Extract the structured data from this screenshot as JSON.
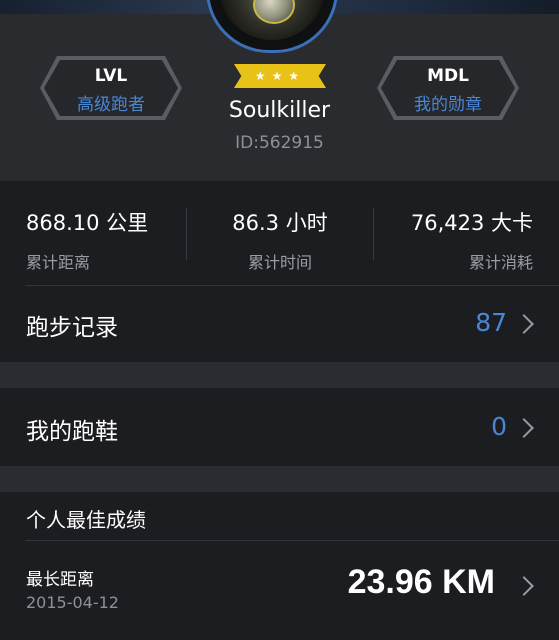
{
  "profile": {
    "username": "Soulkiller",
    "user_id": "ID:562915",
    "rank_stars": "★★★"
  },
  "badges": {
    "level": {
      "code": "LVL",
      "label": "高级跑者"
    },
    "medal": {
      "code": "MDL",
      "label": "我的勋章"
    }
  },
  "stats": [
    {
      "value": "868.10 公里",
      "label": "累计距离"
    },
    {
      "value": "86.3 小时",
      "label": "累计时间"
    },
    {
      "value": "76,423 大卡",
      "label": "累计消耗"
    }
  ],
  "menu": {
    "run_records": {
      "label": "跑步记录",
      "count": "87"
    },
    "my_shoes": {
      "label": "我的跑鞋",
      "count": "0"
    }
  },
  "personal_best": {
    "title": "个人最佳成绩",
    "longest_distance": {
      "label": "最长距离",
      "date": "2015-04-12",
      "value": "23.96 KM"
    }
  },
  "colors": {
    "accent": "#4a86d4",
    "rank_ribbon": "#e9c218",
    "background": "#1f2024"
  },
  "icons": {
    "chevron": "chevron-right-icon",
    "avatar": "avatar-image",
    "stars": "star-icon"
  }
}
